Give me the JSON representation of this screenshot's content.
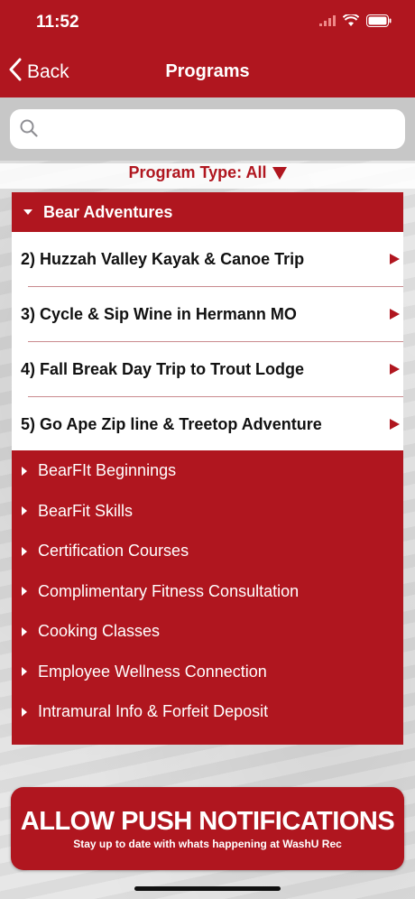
{
  "status_bar": {
    "time": "11:52"
  },
  "nav": {
    "back_label": "Back",
    "title": "Programs"
  },
  "search": {
    "placeholder": ""
  },
  "filter": {
    "label": "Program Type: All"
  },
  "expanded_group": {
    "title": "Bear Adventures",
    "items": [
      "2) Huzzah Valley Kayak & Canoe Trip",
      "3) Cycle & Sip Wine in Hermann MO",
      "4) Fall Break Day Trip to Trout Lodge",
      "5) Go Ape Zip line & Treetop Adventure"
    ]
  },
  "categories": [
    "BearFIt Beginnings",
    "BearFit Skills",
    "Certification Courses",
    "Complimentary Fitness Consultation",
    "Cooking Classes",
    "Employee Wellness Connection",
    "Intramural Info & Forfeit Deposit"
  ],
  "push_banner": {
    "title": "ALLOW PUSH NOTIFICATIONS",
    "subtitle": "Stay up to date with whats happening at WashU Rec"
  },
  "colors": {
    "brand_red": "#b0161f",
    "row_divider": "#c98a8e"
  }
}
